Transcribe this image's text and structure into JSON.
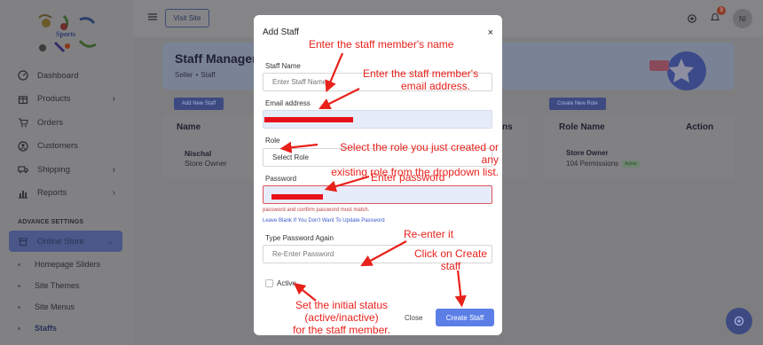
{
  "sidebar": {
    "items": [
      {
        "label": "Dashboard",
        "icon": "dashboard-icon",
        "has_chevron": false
      },
      {
        "label": "Products",
        "icon": "box-icon",
        "has_chevron": true
      },
      {
        "label": "Orders",
        "icon": "cart-icon",
        "has_chevron": false
      },
      {
        "label": "Customers",
        "icon": "user-icon",
        "has_chevron": false
      },
      {
        "label": "Shipping",
        "icon": "truck-icon",
        "has_chevron": true
      },
      {
        "label": "Reports",
        "icon": "chart-icon",
        "has_chevron": true
      }
    ],
    "section_title": "ADVANCE SETTINGS",
    "online_store": "Online Store",
    "sub_items": [
      "Homepage Sliders",
      "Site Themes",
      "Site Menus",
      "Staffs"
    ],
    "logo_text": "Sports"
  },
  "topbar": {
    "visit_site": "Visit Site",
    "notification_count": "3",
    "avatar_initials": "NI"
  },
  "page": {
    "title": "Staff Manageme",
    "breadcrumb": [
      "Seller",
      "Staff"
    ],
    "add_new_staff": "Add New Staff",
    "create_new_role": "Create New Role",
    "staff_table": {
      "header_name": "Name",
      "header_partial": "ns",
      "row_name": "Nischal",
      "row_role": "Store Owner"
    },
    "role_table": {
      "header_role": "Role Name",
      "header_action": "Action",
      "row_role": "Store Owner",
      "row_permissions": "104 Permissions",
      "row_status": "Active"
    }
  },
  "modal": {
    "title": "Add Staff",
    "close_icon": "×",
    "staff_name_label": "Staff Name",
    "staff_name_placeholder": "Enter Staff Name",
    "email_label": "Email address",
    "role_label": "Role",
    "role_value": "Select Role",
    "password_label": "Password",
    "password_error": "password and confirm password must match.",
    "password_hint": "Leave Blank If You Don't Want To Update Password",
    "confirm_label": "Type Password Again",
    "confirm_placeholder": "Re-Enter Password",
    "active_label": "Active",
    "close_button": "Close",
    "create_button": "Create Staff"
  },
  "annotations": {
    "name": "Enter the staff member's name",
    "email_1": "Enter the staff member's",
    "email_2": "email address.",
    "role_1": "Select the role you just created or any",
    "role_2": "existing role from the dropdown list.",
    "password": "Enter password",
    "reenter": "Re-enter it",
    "create_1": "Click on Create",
    "create_2": "staff",
    "status_1": "Set the initial status (active/inactive)",
    "status_2": "for the staff member.",
    "color": "#e8211b"
  }
}
